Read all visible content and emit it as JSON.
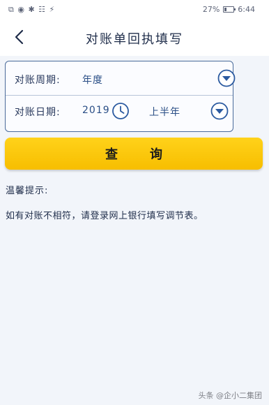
{
  "status_bar": {
    "left_icons": "⧉ ◉ ✱ ☷ ⚡",
    "battery_text": "27%",
    "battery_level": 0.27,
    "time": "6:44"
  },
  "nav": {
    "title": "对账单回执填写"
  },
  "form": {
    "period_label": "对账周期:",
    "period_value": "年度",
    "date_label": "对账日期:",
    "date_year": "2019",
    "date_half": "上半年"
  },
  "query_button": {
    "label": "查询"
  },
  "tips": {
    "title": "温馨提示:",
    "text": "如有对账不相符，请登录网上银行填写调节表。"
  },
  "watermark": {
    "text": "头条 @企小二集团"
  },
  "colors": {
    "accent_blue": "#2b5aa0",
    "button_yellow": "#f9c400"
  }
}
